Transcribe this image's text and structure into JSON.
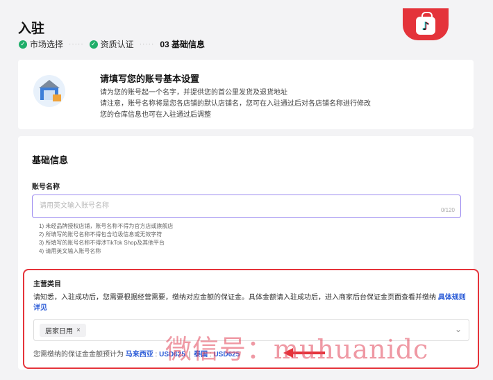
{
  "header": {
    "title": "入驻",
    "steps": [
      {
        "label": "市场选择",
        "status": "done"
      },
      {
        "label": "资质认证",
        "status": "done"
      },
      {
        "label": "03 基础信息",
        "status": "current"
      }
    ],
    "step_separator": "·····"
  },
  "intro": {
    "heading": "请填写您的账号基本设置",
    "lines": [
      "请为您的账号起一个名字，并提供您的首公里发货及退货地址",
      "请注意，账号名称将是您各店铺的默认店铺名，您可在入驻通过后对各店铺名称进行修改",
      "您的仓库信息也可在入驻通过后调整"
    ]
  },
  "basic_info": {
    "section_title": "基础信息",
    "account_name": {
      "label": "账号名称",
      "placeholder": "请用英文输入账号名称",
      "value": "",
      "counter": "0/120"
    },
    "rules": [
      "1) 未经品牌授权店铺，账号名称不得为官方店或旗舰店",
      "2) 所填写的账号名称不得包含垃圾信息或无效字符",
      "3) 所填写的账号名称不得涉TikTok Shop及其他平台",
      "4) 请用英文输入账号名称"
    ]
  },
  "main_category": {
    "title": "主营类目",
    "description": "请知悉，入驻成功后，您需要根据经营需要，缴纳对应金额的保证金。具体金额请入驻成功后，进入商家后台保证金页面查看并缴纳",
    "link_label": "具体规则详见",
    "selected_tag": "居家日用",
    "tag_close": "×",
    "chevron": "⌄",
    "deposit": {
      "prefix": "您需缴纳的保证金金额预计为",
      "items": [
        {
          "country": "马来西亚",
          "amount": "USD625"
        },
        {
          "country": "泰国",
          "amount": "USD625"
        }
      ],
      "separator": "|"
    }
  },
  "watermark": "微信号：muhuanidc",
  "colors": {
    "accent_purple": "#9b8af0",
    "link_blue": "#2a5bd7",
    "highlight_red": "#e5333a",
    "success_green": "#1fae6a"
  },
  "icons": {
    "step_done": "check-circle-icon",
    "tiktok_shop": "tiktok-shop-icon",
    "warehouse": "warehouse-icon",
    "arrow": "arrow-left-icon"
  }
}
